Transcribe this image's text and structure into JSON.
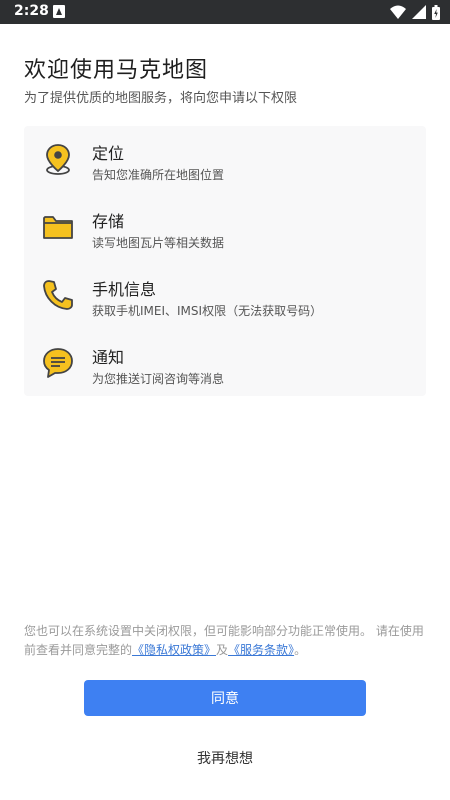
{
  "status_bar": {
    "time": "2:28"
  },
  "header": {
    "title": "欢迎使用马克地图",
    "subtitle": "为了提供优质的地图服务，将向您申请以下权限"
  },
  "permissions": [
    {
      "icon": "location-pin-icon",
      "title": "定位",
      "desc": "告知您准确所在地图位置"
    },
    {
      "icon": "folder-icon",
      "title": "存储",
      "desc": "读写地图瓦片等相关数据"
    },
    {
      "icon": "phone-icon",
      "title": "手机信息",
      "desc": "获取手机IMEI、IMSI权限（无法获取号码）"
    },
    {
      "icon": "chat-bubble-icon",
      "title": "通知",
      "desc": "为您推送订阅咨询等消息"
    }
  ],
  "notice": {
    "text_before": "您也可以在系统设置中关闭权限，但可能影响部分功能正常使用。 请在使用前查看并同意完整的",
    "privacy_link": "《隐私权政策》",
    "middle": "及",
    "terms_link": "《服务条款》",
    "end": "。"
  },
  "buttons": {
    "agree": "同意",
    "later": "我再想想"
  },
  "colors": {
    "accent": "#3e80f2",
    "icon_yellow": "#f5c11f",
    "link": "#3a78d6"
  }
}
